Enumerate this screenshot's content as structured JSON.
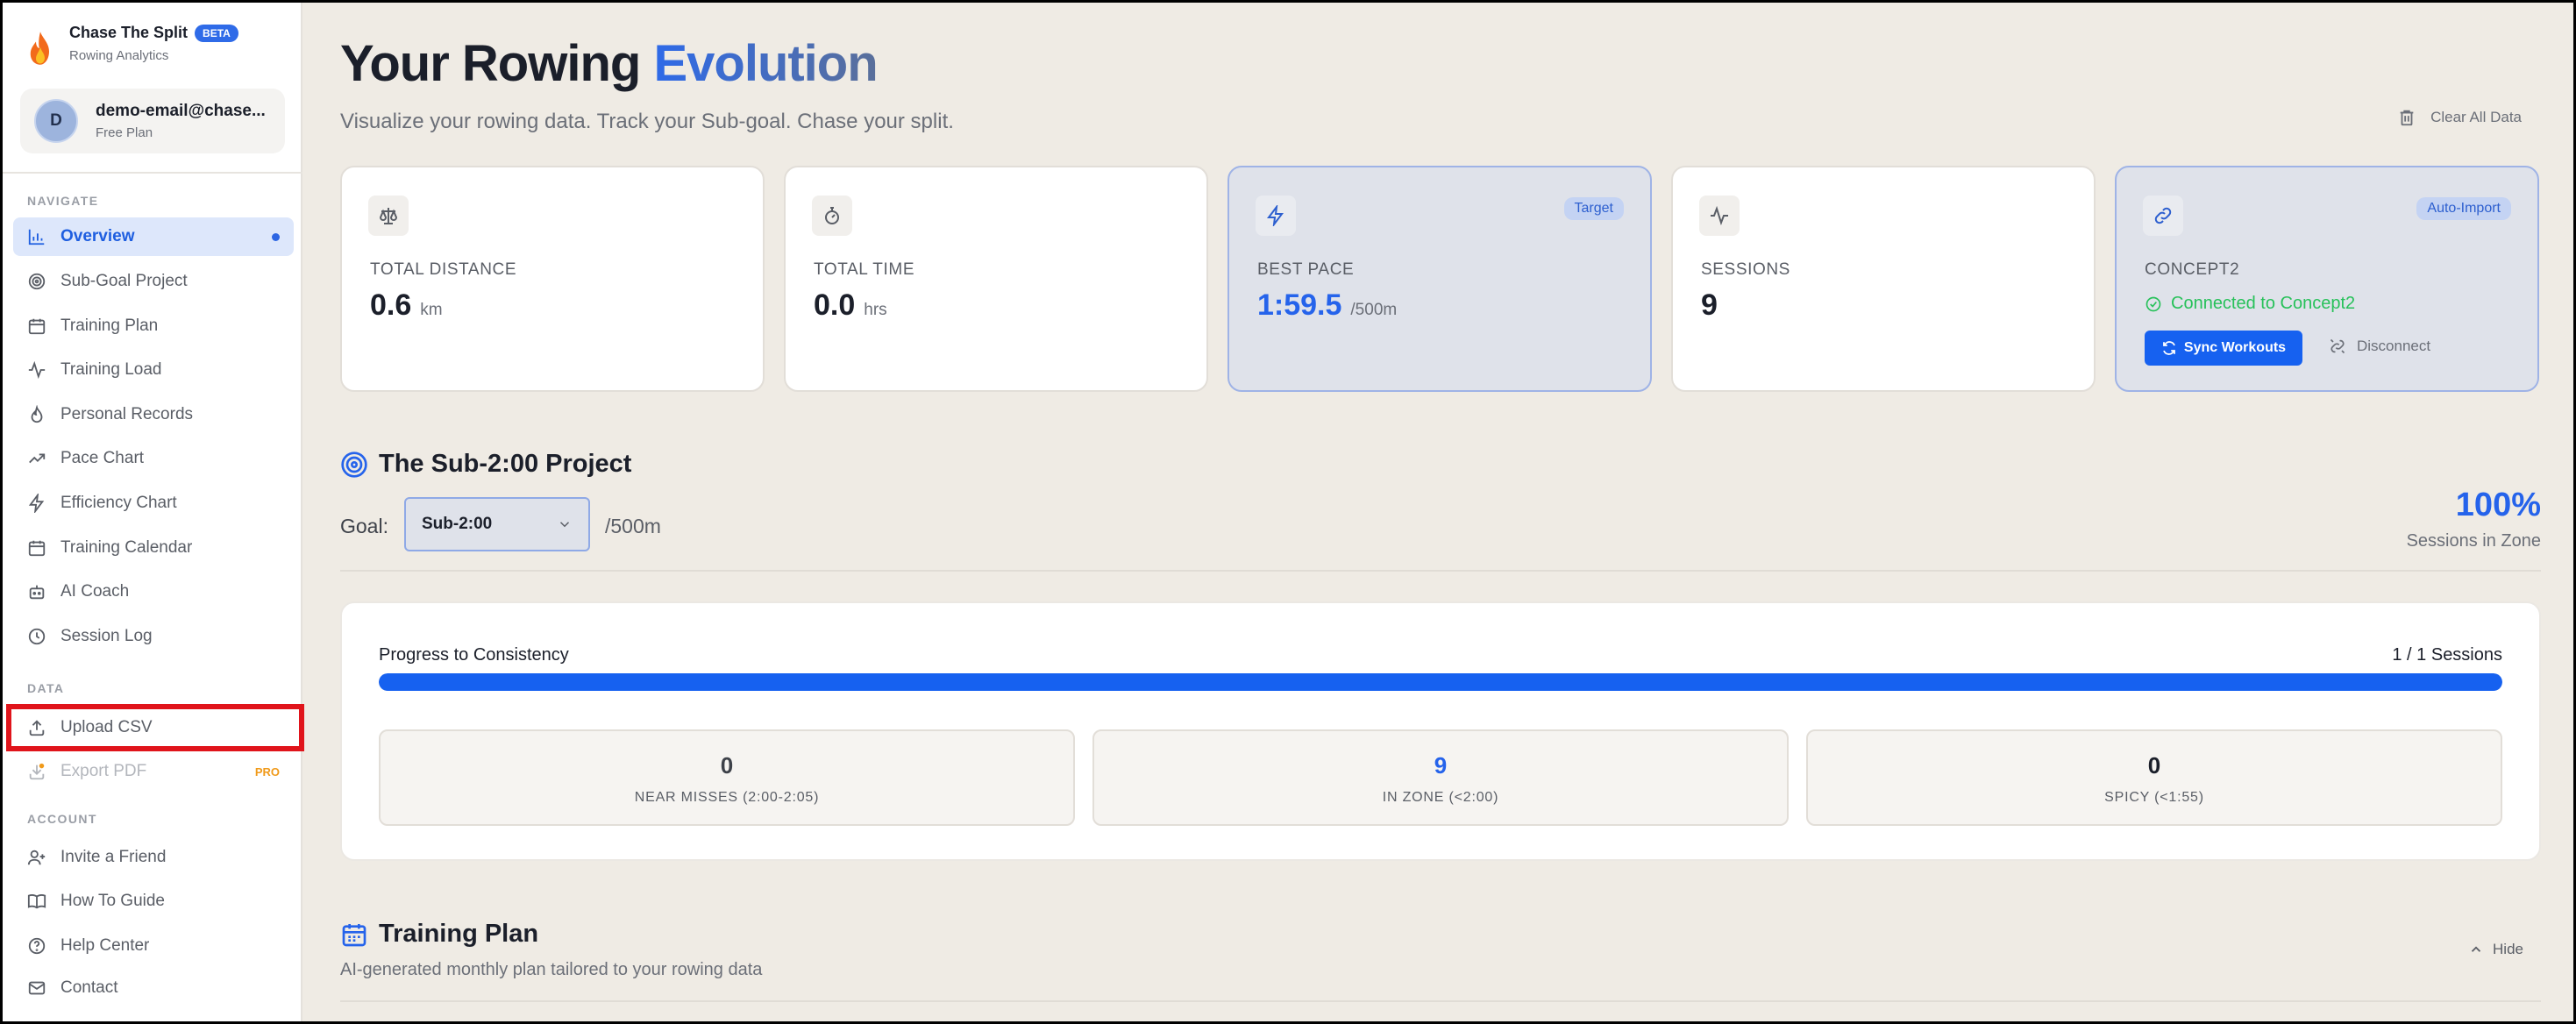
{
  "brand": {
    "name": "Chase The Split",
    "badge": "BETA",
    "subtitle": "Rowing Analytics",
    "icon": "flame-icon"
  },
  "user": {
    "initial": "D",
    "email": "demo-email@chase...",
    "plan": "Free Plan"
  },
  "sidebar": {
    "navigate_label": "NAVIGATE",
    "navigate": [
      {
        "label": "Overview",
        "icon": "bar-chart-icon",
        "active": true
      },
      {
        "label": "Sub-Goal Project",
        "icon": "target-icon"
      },
      {
        "label": "Training Plan",
        "icon": "calendar-icon"
      },
      {
        "label": "Training Load",
        "icon": "activity-icon"
      },
      {
        "label": "Personal Records",
        "icon": "flame-outline-icon"
      },
      {
        "label": "Pace Chart",
        "icon": "trending-up-icon"
      },
      {
        "label": "Efficiency Chart",
        "icon": "bolt-icon"
      },
      {
        "label": "Training Calendar",
        "icon": "calendar-icon"
      },
      {
        "label": "AI Coach",
        "icon": "robot-icon"
      },
      {
        "label": "Session Log",
        "icon": "clock-icon"
      }
    ],
    "data_label": "DATA",
    "data": [
      {
        "label": "Upload CSV",
        "icon": "upload-icon"
      },
      {
        "label": "Export PDF",
        "icon": "export-icon",
        "badge": "PRO",
        "disabled": true
      }
    ],
    "account_label": "ACCOUNT",
    "account": [
      {
        "label": "Invite a Friend",
        "icon": "user-plus-icon"
      },
      {
        "label": "How To Guide",
        "icon": "book-icon"
      },
      {
        "label": "Help Center",
        "icon": "help-circle-icon"
      },
      {
        "label": "Contact",
        "icon": "mail-icon"
      }
    ]
  },
  "header": {
    "title_main": "Your Rowing",
    "title_accent": "Evolution",
    "subtitle": "Visualize your rowing data. Track your Sub-goal. Chase your split.",
    "clear_label": "Clear All Data"
  },
  "stats": [
    {
      "label": "TOTAL DISTANCE",
      "value": "0.6",
      "unit": "km",
      "icon": "scale-icon"
    },
    {
      "label": "TOTAL TIME",
      "value": "0.0",
      "unit": "hrs",
      "icon": "stopwatch-icon"
    },
    {
      "label": "BEST PACE",
      "value": "1:59.5",
      "unit": "/500m",
      "icon": "bolt-icon",
      "tag": "Target"
    },
    {
      "label": "SESSIONS",
      "value": "9",
      "unit": "",
      "icon": "activity-icon"
    },
    {
      "label": "CONCEPT2",
      "icon": "link-icon",
      "tag": "Auto-Import",
      "status": "Connected to Concept2",
      "sync_label": "Sync Workouts",
      "disconnect_label": "Disconnect"
    }
  ],
  "project": {
    "title": "The Sub-2:00 Project",
    "goal_label": "Goal:",
    "goal_value": "Sub-2:00",
    "goal_unit": "/500m",
    "zone_percent": "100%",
    "zone_label": "Sessions in Zone",
    "progress_title": "Progress to Consistency",
    "progress_count": "1 / 1 Sessions",
    "progress_fraction": 1.0,
    "zones": [
      {
        "value": "0",
        "label": "NEAR MISSES (2:00-2:05)"
      },
      {
        "value": "9",
        "label": "IN ZONE (<2:00)"
      },
      {
        "value": "0",
        "label": "SPICY (<1:55)"
      }
    ]
  },
  "plan": {
    "title": "Training Plan",
    "subtitle": "AI-generated monthly plan tailored to your rowing data",
    "hide_label": "Hide"
  },
  "colors": {
    "accent": "#2563eb",
    "highlight_border": "#e0141b",
    "connected": "#27c15a"
  }
}
